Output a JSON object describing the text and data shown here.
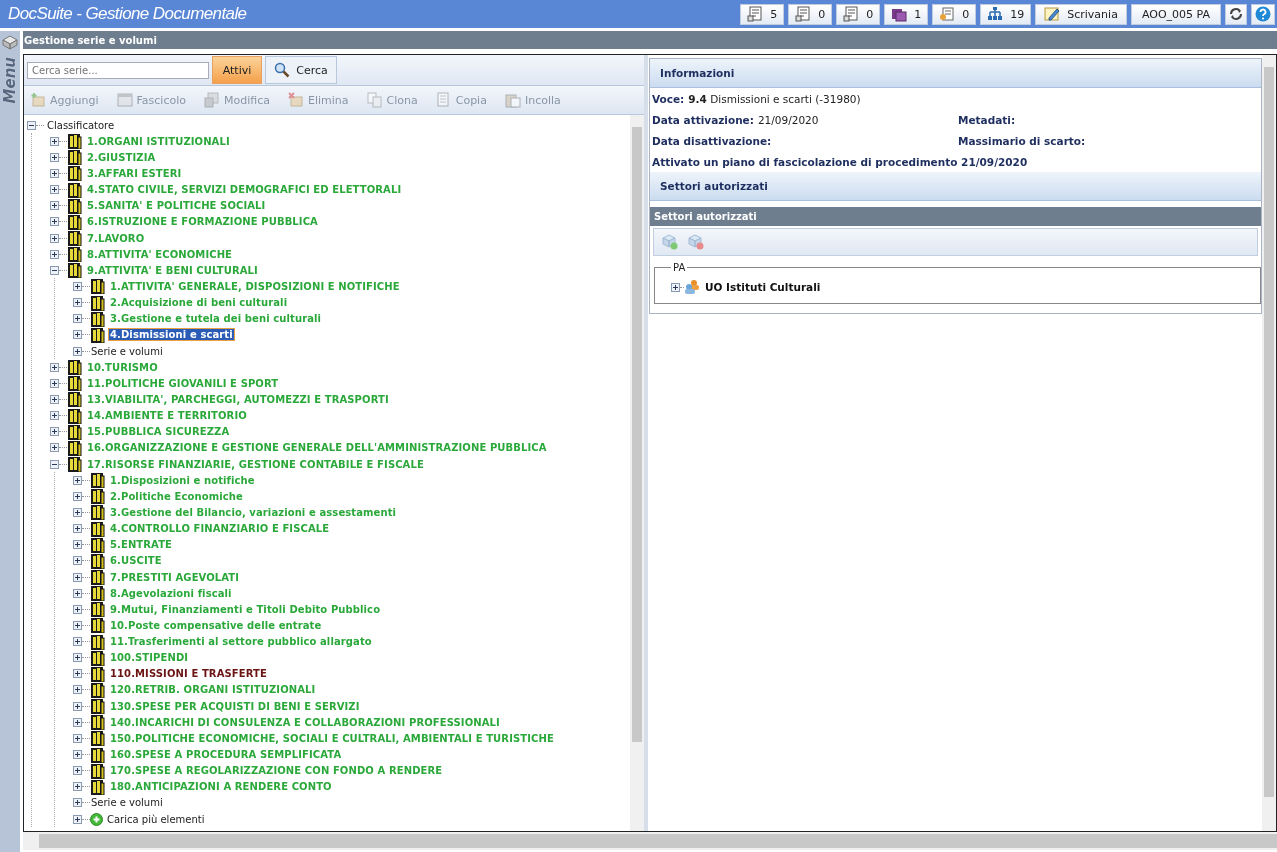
{
  "window": {
    "title": "DocSuite - Gestione Documentale"
  },
  "header_counters": [
    {
      "count": "5"
    },
    {
      "count": "0"
    },
    {
      "count": "0"
    },
    {
      "count": "1"
    },
    {
      "count": "0"
    },
    {
      "count": "19"
    }
  ],
  "header_buttons": [
    {
      "label": "Scrivania",
      "kind": "desk"
    },
    {
      "label": "AOO_005 PA",
      "kind": "plain"
    }
  ],
  "side_menu": {
    "label": "Menu"
  },
  "page_title": "Gestione serie e volumi",
  "search": {
    "placeholder": "Cerca serie...",
    "filter": {
      "label": "Attivi",
      "selected": true
    },
    "button": "Cerca"
  },
  "toolbar": [
    {
      "label": "Aggiungi",
      "disabled": true
    },
    {
      "label": "Fascicolo",
      "disabled": true
    },
    {
      "label": "Modifica",
      "disabled": true
    },
    {
      "label": "Elimina",
      "disabled": true
    },
    {
      "label": "Clona",
      "disabled": true
    },
    {
      "label": "Copia",
      "disabled": true
    },
    {
      "label": "Incolla",
      "disabled": true
    }
  ],
  "tree": {
    "label": "Classificatore",
    "expanded": true,
    "selected": false,
    "children": [
      {
        "kind": "class",
        "label": "1.ORGANI ISTITUZIONALI",
        "color": "#2aa83a",
        "expanded": false,
        "selected": false
      },
      {
        "kind": "class",
        "label": "2.GIUSTIZIA",
        "color": "#2aa83a",
        "expanded": false,
        "selected": false
      },
      {
        "kind": "class",
        "label": "3.AFFARI ESTERI",
        "color": "#2aa83a",
        "expanded": false,
        "selected": false
      },
      {
        "kind": "class",
        "label": "4.STATO CIVILE, SERVIZI DEMOGRAFICI ED ELETTORALI",
        "color": "#2aa83a",
        "expanded": false,
        "selected": false
      },
      {
        "kind": "class",
        "label": "5.SANITA' E POLITICHE SOCIALI",
        "color": "#2aa83a",
        "expanded": false,
        "selected": false
      },
      {
        "kind": "class",
        "label": "6.ISTRUZIONE E FORMAZIONE PUBBLICA",
        "color": "#2aa83a",
        "expanded": false,
        "selected": false
      },
      {
        "kind": "class",
        "label": "7.LAVORO",
        "color": "#2aa83a",
        "expanded": false,
        "selected": false
      },
      {
        "kind": "class",
        "label": "8.ATTIVITA' ECONOMICHE",
        "color": "#2aa83a",
        "expanded": false,
        "selected": false
      },
      {
        "kind": "class",
        "label": "9.ATTIVITA' E BENI CULTURALI",
        "color": "#2aa83a",
        "expanded": true,
        "selected": false,
        "children": [
          {
            "kind": "class",
            "label": "1.ATTIVITA' GENERALE, DISPOSIZIONI E NOTIFICHE",
            "color": "#2aa83a",
            "expanded": false,
            "selected": false
          },
          {
            "kind": "class",
            "label": "2.Acquisizione di beni culturali",
            "color": "#2aa83a",
            "expanded": false,
            "selected": false
          },
          {
            "kind": "class",
            "label": "3.Gestione e tutela dei beni culturali",
            "color": "#2aa83a",
            "expanded": false,
            "selected": false
          },
          {
            "kind": "class",
            "label": "4.Dismissioni e scarti",
            "expanded": false,
            "selected": true
          },
          {
            "kind": "series",
            "label": "Serie e volumi",
            "expanded": false,
            "selected": false
          }
        ]
      },
      {
        "kind": "class",
        "label": "10.TURISMO",
        "color": "#2aa83a",
        "expanded": false,
        "selected": false
      },
      {
        "kind": "class",
        "label": "11.POLITICHE GIOVANILI E SPORT",
        "color": "#2aa83a",
        "expanded": false,
        "selected": false
      },
      {
        "kind": "class",
        "label": "13.VIABILITA', PARCHEGGI, AUTOMEZZI E TRASPORTI",
        "color": "#2aa83a",
        "expanded": false,
        "selected": false
      },
      {
        "kind": "class",
        "label": "14.AMBIENTE E TERRITORIO",
        "color": "#2aa83a",
        "expanded": false,
        "selected": false
      },
      {
        "kind": "class",
        "label": "15.PUBBLICA SICUREZZA",
        "color": "#2aa83a",
        "expanded": false,
        "selected": false
      },
      {
        "kind": "class",
        "label": "16.ORGANIZZAZIONE E GESTIONE GENERALE DELL'AMMINISTRAZIONE PUBBLICA",
        "color": "#2aa83a",
        "expanded": false,
        "selected": false
      },
      {
        "kind": "class",
        "label": "17.RISORSE FINANZIARIE, GESTIONE CONTABILE E FISCALE",
        "color": "#2aa83a",
        "expanded": true,
        "selected": false,
        "children": [
          {
            "kind": "class",
            "label": "1.Disposizioni e notifiche",
            "color": "#2aa83a",
            "expanded": false,
            "selected": false
          },
          {
            "kind": "class",
            "label": "2.Politiche Economiche",
            "color": "#2aa83a",
            "expanded": false,
            "selected": false
          },
          {
            "kind": "class",
            "label": "3.Gestione del Bilancio, variazioni e assestamenti",
            "color": "#2aa83a",
            "expanded": false,
            "selected": false
          },
          {
            "kind": "class",
            "label": "4.CONTROLLO FINANZIARIO E FISCALE",
            "color": "#2aa83a",
            "expanded": false,
            "selected": false
          },
          {
            "kind": "class",
            "label": "5.ENTRATE",
            "color": "#2aa83a",
            "expanded": false,
            "selected": false
          },
          {
            "kind": "class",
            "label": "6.USCITE",
            "color": "#2aa83a",
            "expanded": false,
            "selected": false
          },
          {
            "kind": "class",
            "label": "7.PRESTITI AGEVOLATI",
            "color": "#2aa83a",
            "expanded": false,
            "selected": false
          },
          {
            "kind": "class",
            "label": "8.Agevolazioni fiscali",
            "color": "#2aa83a",
            "expanded": false,
            "selected": false
          },
          {
            "kind": "class",
            "label": "9.Mutui, Finanziamenti e Titoli Debito Pubblico",
            "color": "#2aa83a",
            "expanded": false,
            "selected": false
          },
          {
            "kind": "class",
            "label": "10.Poste compensative delle entrate",
            "color": "#2aa83a",
            "expanded": false,
            "selected": false
          },
          {
            "kind": "class",
            "label": "11.Trasferimenti al settore pubblico allargato",
            "color": "#2aa83a",
            "expanded": false,
            "selected": false
          },
          {
            "kind": "class",
            "label": "100.STIPENDI",
            "color": "#2aa83a",
            "expanded": false,
            "selected": false
          },
          {
            "kind": "class",
            "label": "110.MISSIONI E TRASFERTE",
            "color": "#6b1414",
            "expanded": false,
            "selected": false
          },
          {
            "kind": "class",
            "label": "120.RETRIB. ORGANI ISTITUZIONALI",
            "color": "#2aa83a",
            "expanded": false,
            "selected": false
          },
          {
            "kind": "class",
            "label": "130.SPESE PER ACQUISTI DI BENI E SERVIZI",
            "color": "#2aa83a",
            "expanded": false,
            "selected": false
          },
          {
            "kind": "class",
            "label": "140.INCARICHI DI CONSULENZA E COLLABORAZIONI PROFESSIONALI",
            "color": "#2aa83a",
            "expanded": false,
            "selected": false
          },
          {
            "kind": "class",
            "label": "150.POLITICHE ECONOMICHE, SOCIALI E CULTRALI, AMBIENTALI E TURISTICHE",
            "color": "#2aa83a",
            "expanded": false,
            "selected": false
          },
          {
            "kind": "class",
            "label": "160.SPESE A PROCEDURA SEMPLIFICATA",
            "color": "#2aa83a",
            "expanded": false,
            "selected": false
          },
          {
            "kind": "class",
            "label": "170.SPESE A REGOLARIZZAZIONE CON FONDO A RENDERE",
            "color": "#2aa83a",
            "expanded": false,
            "selected": false
          },
          {
            "kind": "class",
            "label": "180.ANTICIPAZIONI A RENDERE CONTO",
            "color": "#2aa83a",
            "expanded": false,
            "selected": false
          },
          {
            "kind": "series",
            "label": "Serie e volumi",
            "expanded": false,
            "selected": false
          },
          {
            "kind": "load_more",
            "label": "Carica più elementi",
            "expanded": false,
            "selected": false
          }
        ]
      }
    ]
  },
  "info": {
    "title": "Informazioni",
    "voce": {
      "label": "Voce:",
      "value": "**9.4** Dismissioni e scarti (-31980)"
    },
    "fields": [
      {
        "label": "Data attivazione:",
        "value": "21/09/2020"
      },
      {
        "label": "Metadati:"
      },
      {
        "label": "Data disattivazione:"
      },
      {
        "label": "Massimario di scarto:"
      }
    ],
    "note": "Attivato un piano di fascicolazione di procedimento 21/09/2020"
  },
  "sectors": {
    "title": "Settori autorizzati",
    "grid_title": "Settori autorizzati",
    "group": "PA",
    "nodes": [
      {
        "label": "UO Istituti Culturali",
        "expanded": false
      }
    ]
  }
}
